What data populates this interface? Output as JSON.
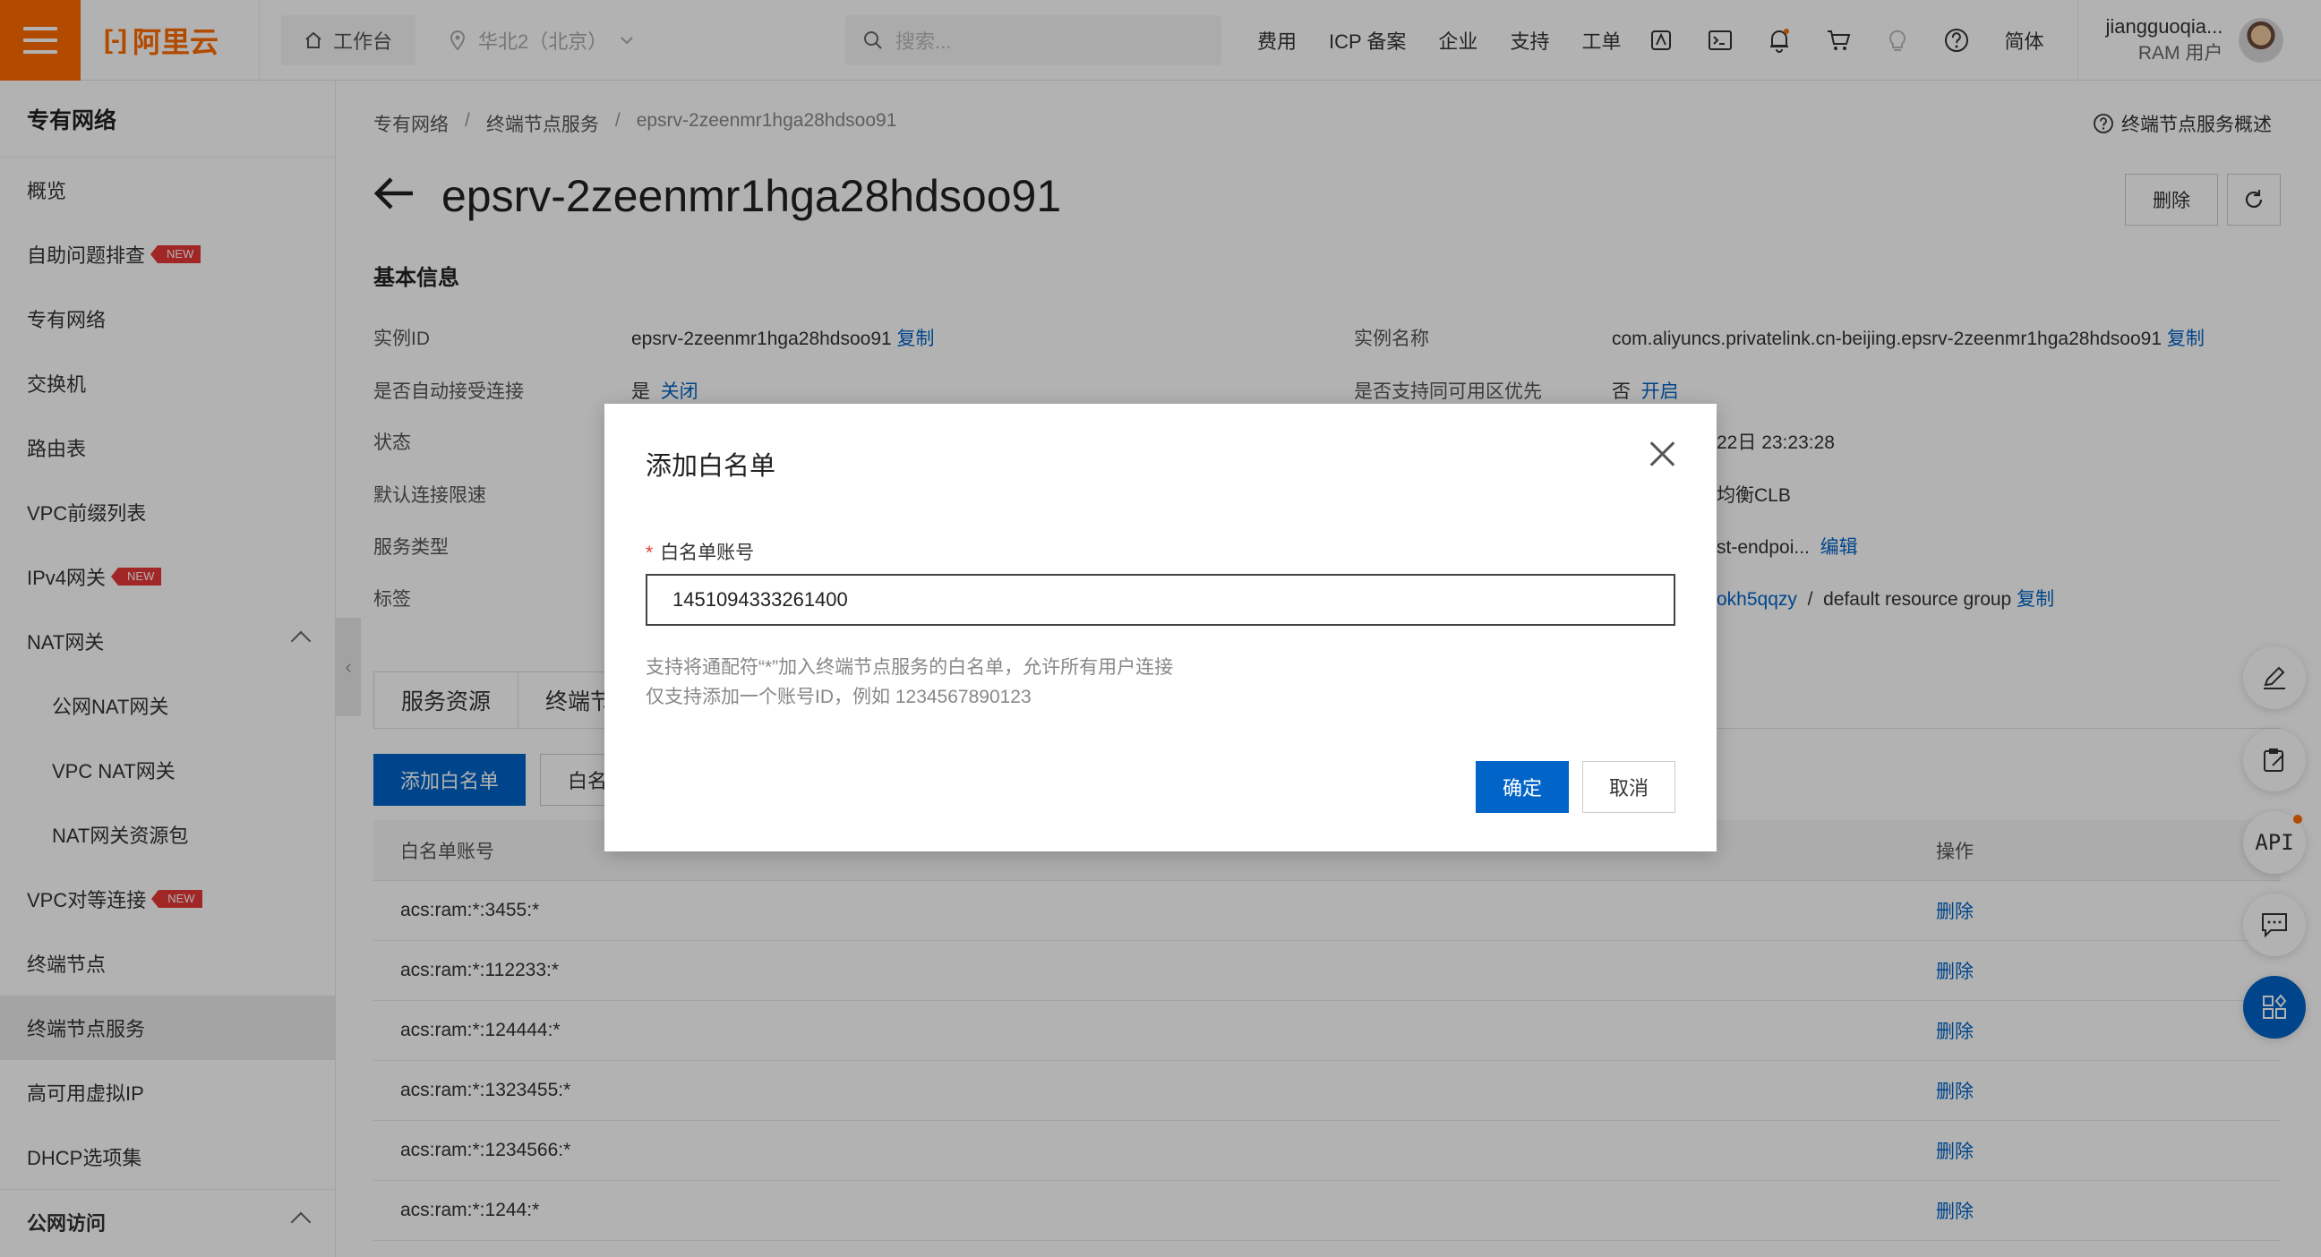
{
  "topbar": {
    "logo_text": "阿里云",
    "workbench": "工作台",
    "region": "华北2（北京）",
    "search_placeholder": "搜索...",
    "nav": [
      "费用",
      "ICP 备案",
      "企业",
      "支持",
      "工单"
    ],
    "lang": "简体",
    "user_name": "jiangguoqia...",
    "user_role": "RAM 用户"
  },
  "sidebar": {
    "title": "专有网络",
    "items": [
      {
        "label": "概览"
      },
      {
        "label": "自助问题排查",
        "badge": "NEW"
      },
      {
        "label": "专有网络"
      },
      {
        "label": "交换机"
      },
      {
        "label": "路由表"
      },
      {
        "label": "VPC前缀列表"
      },
      {
        "label": "IPv4网关",
        "badge": "NEW"
      },
      {
        "label": "NAT网关"
      },
      {
        "label": "公网NAT网关"
      },
      {
        "label": "VPC NAT网关"
      },
      {
        "label": "NAT网关资源包"
      },
      {
        "label": "VPC对等连接",
        "badge": "NEW"
      },
      {
        "label": "终端节点"
      },
      {
        "label": "终端节点服务"
      },
      {
        "label": "高可用虚拟IP"
      },
      {
        "label": "DHCP选项集"
      },
      {
        "label": "公网访问"
      }
    ]
  },
  "breadcrumb": [
    "专有网络",
    "终端节点服务",
    "epsrv-2zeenmr1hga28hdsoo91"
  ],
  "overview_link": "终端节点服务概述",
  "page_title": "epsrv-2zeenmr1hga28hdsoo91",
  "actions": {
    "delete": "删除"
  },
  "basic_info": {
    "title": "基本信息",
    "instance_id_label": "实例ID",
    "instance_id": "epsrv-2zeenmr1hga28hdsoo91",
    "copy": "复制",
    "auto_accept_label": "是否自动接受连接",
    "auto_accept_value": "是",
    "auto_accept_action": "关闭",
    "status_label": "状态",
    "rate_label": "默认连接限速",
    "service_type_label": "服务类型",
    "tags_label": "标签",
    "instance_name_label": "实例名称",
    "instance_name": "com.aliyuncs.privatelink.cn-beijing.epsrv-2zeenmr1hga28hdsoo91",
    "zone_priority_label": "是否支持同可用区优先",
    "zone_priority_value": "否",
    "zone_priority_action": "开启",
    "created_partial": "22日 23:23:28",
    "lb_partial": "均衡CLB",
    "desc_partial": "st-endpoi...",
    "edit": "编辑",
    "rg_partial": "okh5qqzy",
    "rg_sep": "/",
    "rg_name": "default resource group"
  },
  "tabs": [
    "服务资源",
    "终端节"
  ],
  "whitelist": {
    "add_button": "添加白名单",
    "other_button": "白名",
    "col_account": "白名单账号",
    "col_op": "操作",
    "rows": [
      {
        "account": "acs:ram:*:3455:*",
        "op": "删除"
      },
      {
        "account": "acs:ram:*:112233:*",
        "op": "删除"
      },
      {
        "account": "acs:ram:*:124444:*",
        "op": "删除"
      },
      {
        "account": "acs:ram:*:1323455:*",
        "op": "删除"
      },
      {
        "account": "acs:ram:*:1234566:*",
        "op": "删除"
      },
      {
        "account": "acs:ram:*:1244:*",
        "op": "删除"
      }
    ]
  },
  "float_tools": {
    "api_label": "API"
  },
  "modal": {
    "title": "添加白名单",
    "field_label": "白名单账号",
    "required_mark": "*",
    "input_value": "1451094333261400",
    "hint1": "支持将通配符“*”加入终端节点服务的白名单，允许所有用户连接",
    "hint2": "仅支持添加一个账号ID，例如 1234567890123",
    "ok": "确定",
    "cancel": "取消"
  },
  "colors": {
    "brand": "#ff6a00",
    "primary": "#0064c8",
    "badge": "#e53935"
  }
}
